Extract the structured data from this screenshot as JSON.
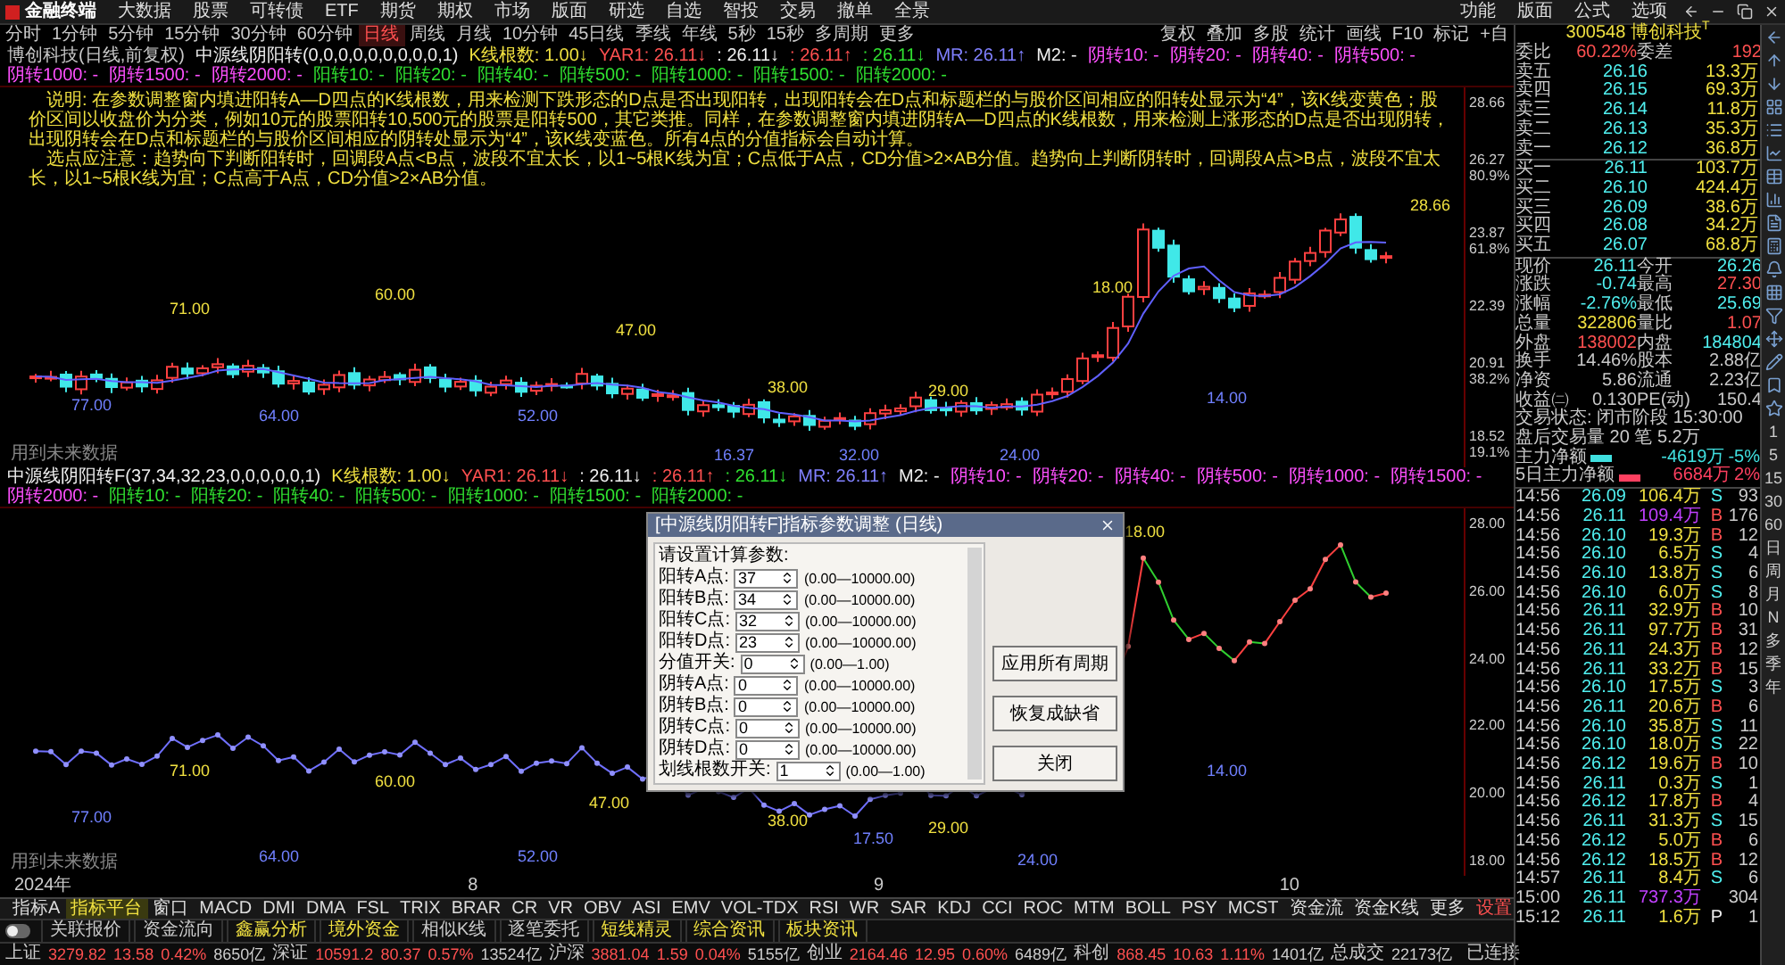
{
  "top_bar": {
    "logo": "金融终端",
    "menu": [
      "大数据",
      "股票",
      "可转债",
      "ETF",
      "期货",
      "期权",
      "市场",
      "版面",
      "研选",
      "自选",
      "智投",
      "交易",
      "撤单",
      "全景"
    ],
    "right_menu": [
      "功能",
      "版面",
      "公式",
      "选项"
    ]
  },
  "period_bar": {
    "periods": [
      {
        "label": "分时",
        "selected": false
      },
      {
        "label": "1分钟",
        "selected": false
      },
      {
        "label": "5分钟",
        "selected": false
      },
      {
        "label": "15分钟",
        "selected": false
      },
      {
        "label": "30分钟",
        "selected": false
      },
      {
        "label": "60分钟",
        "selected": false
      },
      {
        "label": "日线",
        "selected": true
      },
      {
        "label": "周线",
        "selected": false
      },
      {
        "label": "月线",
        "selected": false
      },
      {
        "label": "10分钟",
        "selected": false
      },
      {
        "label": "45日线",
        "selected": false
      },
      {
        "label": "季线",
        "selected": false
      },
      {
        "label": "年线",
        "selected": false
      },
      {
        "label": "5秒",
        "selected": false
      },
      {
        "label": "15秒",
        "selected": false
      },
      {
        "label": "多周期",
        "selected": false
      },
      {
        "label": "更多",
        "selected": false
      }
    ],
    "tools": [
      "复权",
      "叠加",
      "多股",
      "统计",
      "画线",
      "F10",
      "标记",
      "+自"
    ]
  },
  "main_header": [
    {
      "text": "博创科技(日线,前复权)",
      "color": "#c8c8c8"
    },
    {
      "text": "中源线阴阳转(0,0,0,0,0,0,0,0,0,1)",
      "color": "#f0f0f0"
    },
    {
      "text": "K线根数: 1.00↓",
      "color": "#f0e040"
    },
    {
      "text": "YAR1: 26.11↓",
      "color": "#ff5050"
    },
    {
      "text": ": 26.11↓",
      "color": "#f0f0f0"
    },
    {
      "text": ": 26.11↑",
      "color": "#ff5050"
    },
    {
      "text": ": 26.11↓",
      "color": "#30e030"
    },
    {
      "text": "MR: 26.11↑",
      "color": "#8080ff"
    },
    {
      "text": "M2: -",
      "color": "#f0f0f0"
    },
    {
      "text": "阴转10: -",
      "color": "#ff50ff"
    },
    {
      "text": "阴转20: -",
      "color": "#ff50ff"
    },
    {
      "text": "阴转40: -",
      "color": "#ff50ff"
    },
    {
      "text": "阴转500: -",
      "color": "#ff50ff"
    },
    {
      "text": "阴转1000: -",
      "color": "#ff50ff"
    },
    {
      "text": "阴转1500: -",
      "color": "#ff50ff"
    },
    {
      "text": "阴转2000: -",
      "color": "#ff50ff"
    },
    {
      "text": "阳转10: -",
      "color": "#30e030"
    },
    {
      "text": "阳转20: -",
      "color": "#30e030"
    },
    {
      "text": "阳转40: -",
      "color": "#30e030"
    },
    {
      "text": "阳转500: -",
      "color": "#30e030"
    },
    {
      "text": "阳转1000: -",
      "color": "#30e030"
    },
    {
      "text": "阳转1500: -",
      "color": "#30e030"
    },
    {
      "text": "阳转2000: -",
      "color": "#30e030"
    }
  ],
  "explanation": [
    "说明: 在参数调整窗内填进阳转A—D四点的K线根数，用来检测下跌形态的D点是否出现阳转，出现阳转会在D点和标题栏的与股价区间相应的阳转处显示为“4”，该K线变黄色；股价区间以收盘价为分类，例如10元的股票阳转10,500元的股票是阳转500，其它类推。同样，在参数调整窗内填进阴转A—D四点的K线根数，用来检测上涨形态的D点是否出现阴转，出现阴转会在D点和标题栏的与股价区间相应的阴转处显示为“4”，该K线变蓝色。所有4点的分值指标会自动计算。",
    "选点应注意：趋势向下判断阳转时，回调段A点<B点，波段不宜太长，以1~5根K线为宜；C点低于A点，CD分值>2×AB分值。趋势向上判断阴转时，回调段A点>B点，波段不宜太长，以1~5根K线为宜；C点高于A点，CD分值>2×AB分值。"
  ],
  "main_chart": {
    "labels": [
      "71.00",
      "60.00",
      "47.00",
      "38.00",
      "29.00",
      "18.00",
      "28.66",
      "77.00",
      "64.00",
      "52.00",
      "16.37",
      "32.00",
      "24.00",
      "14.00"
    ],
    "note": "用到未来数据",
    "axis": [
      {
        "value": "28.66"
      },
      {
        "value": "26.27",
        "pct": "80.9%"
      },
      {
        "value": "23.87",
        "pct": "61.8%"
      },
      {
        "value": "22.39"
      },
      {
        "value": "20.91",
        "pct": "38.2%"
      },
      {
        "value": "18.52",
        "pct": "19.1%"
      }
    ]
  },
  "lower_header": [
    {
      "text": "中源线阴阳转F(37,34,32,23,0,0,0,0,0,1)",
      "color": "#f0f0f0"
    },
    {
      "text": "K线根数: 1.00↓",
      "color": "#f0e040"
    },
    {
      "text": "YAR1: 26.11↓",
      "color": "#ff5050"
    },
    {
      "text": ": 26.11↓",
      "color": "#f0f0f0"
    },
    {
      "text": ": 26.11↑",
      "color": "#ff5050"
    },
    {
      "text": ": 26.11↓",
      "color": "#30e030"
    },
    {
      "text": "MR: 26.11↑",
      "color": "#8080ff"
    },
    {
      "text": "M2: -",
      "color": "#f0f0f0"
    },
    {
      "text": "阴转10: -",
      "color": "#ff50ff"
    },
    {
      "text": "阴转20: -",
      "color": "#ff50ff"
    },
    {
      "text": "阴转40: -",
      "color": "#ff50ff"
    },
    {
      "text": "阴转500: -",
      "color": "#ff50ff"
    },
    {
      "text": "阴转1000: -",
      "color": "#ff50ff"
    },
    {
      "text": "阴转1500: -",
      "color": "#ff50ff"
    },
    {
      "text": "阴转2000: -",
      "color": "#ff50ff"
    },
    {
      "text": "阳转10: -",
      "color": "#30e030"
    },
    {
      "text": "阳转20: -",
      "color": "#30e030"
    },
    {
      "text": "阳转40: -",
      "color": "#30e030"
    },
    {
      "text": "阳转500: -",
      "color": "#30e030"
    },
    {
      "text": "阳转1000: -",
      "color": "#30e030"
    },
    {
      "text": "阳转1500: -",
      "color": "#30e030"
    },
    {
      "text": "阳转2000: -",
      "color": "#30e030"
    }
  ],
  "lower_chart": {
    "labels": [
      "71.00",
      "60.00",
      "47.00",
      "38.00",
      "29.00",
      "18.00",
      "77.00",
      "64.00",
      "52.00",
      "14.00",
      "24.00",
      "17.50"
    ],
    "note": "用到未来数据",
    "axis": [
      "28.00",
      "26.00",
      "24.00",
      "22.00",
      "20.00",
      "18.00"
    ]
  },
  "date_axis": [
    "2024年",
    "8",
    "9",
    "10"
  ],
  "dialog": {
    "title": "[中源线阴阳转F]指标参数调整 (日线)",
    "prompt": "请设置计算参数:",
    "params": [
      {
        "label": "阳转A点:",
        "value": "37",
        "range": "(0.00—10000.00)"
      },
      {
        "label": "阳转B点:",
        "value": "34",
        "range": "(0.00—10000.00)"
      },
      {
        "label": "阳转C点:",
        "value": "32",
        "range": "(0.00—10000.00)"
      },
      {
        "label": "阳转D点:",
        "value": "23",
        "range": "(0.00—10000.00)"
      },
      {
        "label": "分值开关:",
        "value": "0",
        "range": "(0.00—1.00)"
      },
      {
        "label": "阴转A点:",
        "value": "0",
        "range": "(0.00—10000.00)"
      },
      {
        "label": "阴转B点:",
        "value": "0",
        "range": "(0.00—10000.00)"
      },
      {
        "label": "阴转C点:",
        "value": "0",
        "range": "(0.00—10000.00)"
      },
      {
        "label": "阴转D点:",
        "value": "0",
        "range": "(0.00—10000.00)"
      },
      {
        "label": "划线根数开关:",
        "value": "1",
        "range": "(0.00—1.00)"
      }
    ],
    "buttons": [
      "应用所有周期",
      "恢复成缺省",
      "关闭"
    ]
  },
  "indicator_tabs": [
    {
      "label": "指标A",
      "selected": false,
      "kind": "tab"
    },
    {
      "label": "指标平台",
      "selected": true,
      "kind": "tab"
    },
    {
      "label": "窗口",
      "selected": false,
      "kind": "tab"
    },
    {
      "label": "MACD",
      "selected": false,
      "kind": "tab"
    },
    {
      "label": "DMI",
      "selected": false,
      "kind": "tab"
    },
    {
      "label": "DMA",
      "selected": false,
      "kind": "tab"
    },
    {
      "label": "FSL",
      "selected": false,
      "kind": "tab"
    },
    {
      "label": "TRIX",
      "selected": false,
      "kind": "tab"
    },
    {
      "label": "BRAR",
      "selected": false,
      "kind": "tab"
    },
    {
      "label": "CR",
      "selected": false,
      "kind": "tab"
    },
    {
      "label": "VR",
      "selected": false,
      "kind": "tab"
    },
    {
      "label": "OBV",
      "selected": false,
      "kind": "tab"
    },
    {
      "label": "ASI",
      "selected": false,
      "kind": "tab"
    },
    {
      "label": "EMV",
      "selected": false,
      "kind": "tab"
    },
    {
      "label": "VOL-TDX",
      "selected": false,
      "kind": "tab"
    },
    {
      "label": "RSI",
      "selected": false,
      "kind": "tab"
    },
    {
      "label": "WR",
      "selected": false,
      "kind": "tab"
    },
    {
      "label": "SAR",
      "selected": false,
      "kind": "tab"
    },
    {
      "label": "KDJ",
      "selected": false,
      "kind": "tab"
    },
    {
      "label": "CCI",
      "selected": false,
      "kind": "tab"
    },
    {
      "label": "ROC",
      "selected": false,
      "kind": "tab"
    },
    {
      "label": "MTM",
      "selected": false,
      "kind": "tab"
    },
    {
      "label": "BOLL",
      "selected": false,
      "kind": "tab"
    },
    {
      "label": "PSY",
      "selected": false,
      "kind": "tab"
    },
    {
      "label": "MCST",
      "selected": false,
      "kind": "tab"
    },
    {
      "label": "资金流",
      "selected": false,
      "kind": "tab"
    },
    {
      "label": "资金K线",
      "selected": false,
      "kind": "tab"
    },
    {
      "label": "更多",
      "selected": false,
      "kind": "tab"
    },
    {
      "label": "设置",
      "selected": false,
      "kind": "settings"
    }
  ],
  "info_bar": {
    "toggle_on": false,
    "tabs": [
      {
        "label": "关联报价",
        "highlight": false
      },
      {
        "label": "资金流向",
        "highlight": false
      },
      {
        "label": "鑫赢分析",
        "highlight": true
      },
      {
        "label": "境外资金",
        "highlight": true
      },
      {
        "label": "相似K线",
        "highlight": false
      },
      {
        "label": "逐笔委托",
        "highlight": false
      },
      {
        "label": "短线精灵",
        "highlight": true
      },
      {
        "label": "综合资讯",
        "highlight": true
      },
      {
        "label": "板块资讯",
        "highlight": true
      }
    ]
  },
  "status_bar": {
    "indices": [
      {
        "name": "上证",
        "value": "3279.82",
        "change": "13.58",
        "pct": "0.42%",
        "amount": "8650亿"
      },
      {
        "name": "深证",
        "value": "10591.2",
        "change": "80.37",
        "pct": "0.57%",
        "amount": "13524亿"
      },
      {
        "name": "沪深",
        "value": "3881.04",
        "change": "1.59",
        "pct": "0.04%",
        "amount": "5155亿"
      },
      {
        "name": "创业",
        "value": "2164.46",
        "change": "12.95",
        "pct": "0.60%",
        "amount": "6489亿"
      },
      {
        "name": "科创",
        "value": "868.45",
        "change": "10.63",
        "pct": "1.11%",
        "amount": "1401亿"
      }
    ],
    "total_label": "总成交",
    "total": "22173亿",
    "connection": "已连接"
  },
  "quote": {
    "code": "300548",
    "name": "博创科技$^{T}$",
    "ratio": [
      {
        "text": "委比",
        "color": "#c8c8c8"
      },
      {
        "text": "60.22%",
        "color": "#ff5050"
      },
      {
        "text": "委差",
        "color": "#c8c8c8"
      },
      {
        "text": "192",
        "color": "#ff5050"
      }
    ],
    "book": [
      {
        "label": "卖五",
        "price": "26.16",
        "volume": "13.3万"
      },
      {
        "label": "卖四",
        "price": "26.15",
        "volume": "69.3万"
      },
      {
        "label": "卖三",
        "price": "26.14",
        "volume": "11.8万"
      },
      {
        "label": "卖二",
        "price": "26.13",
        "volume": "35.3万"
      },
      {
        "label": "卖一",
        "price": "26.12",
        "volume": "36.8万"
      },
      {
        "label": "买一",
        "price": "26.11",
        "volume": "103.7万"
      },
      {
        "label": "买二",
        "price": "26.10",
        "volume": "424.4万"
      },
      {
        "label": "买三",
        "price": "26.09",
        "volume": "38.6万"
      },
      {
        "label": "买四",
        "price": "26.08",
        "volume": "34.2万"
      },
      {
        "label": "买五",
        "price": "26.07",
        "volume": "68.8万"
      }
    ],
    "stats": [
      [
        {
          "text": "现价",
          "color": "#c8c8c8"
        },
        {
          "text": "26.11",
          "color": "#50f0f0"
        },
        {
          "text": "今开",
          "color": "#c8c8c8"
        },
        {
          "text": "26.26",
          "color": "#50f0f0"
        }
      ],
      [
        {
          "text": "涨跌",
          "color": "#c8c8c8"
        },
        {
          "text": "-0.74",
          "color": "#50f0f0"
        },
        {
          "text": "最高",
          "color": "#c8c8c8"
        },
        {
          "text": "27.30",
          "color": "#ff5050"
        }
      ],
      [
        {
          "text": "涨幅",
          "color": "#c8c8c8"
        },
        {
          "text": "-2.76%",
          "color": "#50f0f0"
        },
        {
          "text": "最低",
          "color": "#c8c8c8"
        },
        {
          "text": "25.69",
          "color": "#50f0f0"
        }
      ],
      [
        {
          "text": "总量",
          "color": "#c8c8c8"
        },
        {
          "text": "322806",
          "color": "#f0e040"
        },
        {
          "text": "量比",
          "color": "#c8c8c8"
        },
        {
          "text": "1.07",
          "color": "#ff5050"
        }
      ],
      [
        {
          "text": "外盘",
          "color": "#c8c8c8"
        },
        {
          "text": "138002",
          "color": "#ff5050"
        },
        {
          "text": "内盘",
          "color": "#c8c8c8"
        },
        {
          "text": "184804",
          "color": "#50f0f0"
        }
      ],
      [
        {
          "text": "换手",
          "color": "#c8c8c8"
        },
        {
          "text": "14.46%",
          "color": "#c8c8c8"
        },
        {
          "text": "股本",
          "color": "#c8c8c8"
        },
        {
          "text": "2.88亿",
          "color": "#c8c8c8"
        }
      ],
      [
        {
          "text": "净资",
          "color": "#c8c8c8"
        },
        {
          "text": "5.86",
          "color": "#c8c8c8"
        },
        {
          "text": "流通",
          "color": "#c8c8c8"
        },
        {
          "text": "2.23亿",
          "color": "#c8c8c8"
        }
      ],
      [
        {
          "text": "收益㈡",
          "color": "#c8c8c8"
        },
        {
          "text": "0.130",
          "color": "#c8c8c8"
        },
        {
          "text": "PE(动)",
          "color": "#c8c8c8"
        },
        {
          "text": "150.4",
          "color": "#c8c8c8"
        }
      ]
    ],
    "trade_status": "交易状态: 闭市阶段 15:30:00",
    "after_hours": "盘后交易量 20 笔 5.2万",
    "flows": [
      {
        "label": "主力净额",
        "value": "-4619万",
        "pct": "-5%",
        "color": "#40e0e0"
      },
      {
        "label": "5日主力净额",
        "value": "6684万",
        "pct": "2%",
        "color": "#ff4060"
      }
    ],
    "ticks": [
      {
        "time": "14:56",
        "price": "26.09",
        "volume": "106.4万",
        "side": "S",
        "count": "93",
        "big": false
      },
      {
        "time": "14:56",
        "price": "26.11",
        "volume": "109.4万",
        "side": "B",
        "count": "176",
        "big": true
      },
      {
        "time": "14:56",
        "price": "26.10",
        "volume": "19.3万",
        "side": "B",
        "count": "12",
        "big": false
      },
      {
        "time": "14:56",
        "price": "26.10",
        "volume": "6.5万",
        "side": "S",
        "count": "4",
        "big": false
      },
      {
        "time": "14:56",
        "price": "26.10",
        "volume": "13.8万",
        "side": "S",
        "count": "6",
        "big": false
      },
      {
        "time": "14:56",
        "price": "26.10",
        "volume": "6.0万",
        "side": "S",
        "count": "8",
        "big": false
      },
      {
        "time": "14:56",
        "price": "26.11",
        "volume": "32.9万",
        "side": "B",
        "count": "10",
        "big": false
      },
      {
        "time": "14:56",
        "price": "26.11",
        "volume": "97.7万",
        "side": "B",
        "count": "31",
        "big": false
      },
      {
        "time": "14:56",
        "price": "26.11",
        "volume": "24.3万",
        "side": "B",
        "count": "12",
        "big": false
      },
      {
        "time": "14:56",
        "price": "26.11",
        "volume": "33.2万",
        "side": "B",
        "count": "15",
        "big": false
      },
      {
        "time": "14:56",
        "price": "26.10",
        "volume": "17.5万",
        "side": "S",
        "count": "3",
        "big": false
      },
      {
        "time": "14:56",
        "price": "26.11",
        "volume": "20.6万",
        "side": "B",
        "count": "6",
        "big": false
      },
      {
        "time": "14:56",
        "price": "26.10",
        "volume": "35.8万",
        "side": "S",
        "count": "11",
        "big": false
      },
      {
        "time": "14:56",
        "price": "26.10",
        "volume": "18.0万",
        "side": "S",
        "count": "22",
        "big": false
      },
      {
        "time": "14:56",
        "price": "26.12",
        "volume": "19.6万",
        "side": "B",
        "count": "10",
        "big": false
      },
      {
        "time": "14:56",
        "price": "26.11",
        "volume": "0.3万",
        "side": "S",
        "count": "1",
        "big": false
      },
      {
        "time": "14:56",
        "price": "26.12",
        "volume": "17.8万",
        "side": "B",
        "count": "4",
        "big": false
      },
      {
        "time": "14:56",
        "price": "26.11",
        "volume": "31.3万",
        "side": "S",
        "count": "15",
        "big": false
      },
      {
        "time": "14:56",
        "price": "26.12",
        "volume": "5.0万",
        "side": "B",
        "count": "6",
        "big": false
      },
      {
        "time": "14:56",
        "price": "26.12",
        "volume": "18.5万",
        "side": "B",
        "count": "12",
        "big": false
      },
      {
        "time": "14:57",
        "price": "26.11",
        "volume": "8.4万",
        "side": "S",
        "count": "6",
        "big": false
      },
      {
        "time": "15:00",
        "price": "26.11",
        "volume": "737.3万",
        "count": "304",
        "big": true
      },
      {
        "time": "15:12",
        "price": "26.11",
        "volume": "1.6万",
        "side": "P",
        "count": "1",
        "big": false
      }
    ]
  },
  "side_periods": [
    "1",
    "5",
    "15",
    "30",
    "60",
    "日",
    "周",
    "月",
    "N",
    "多",
    "季",
    "年"
  ]
}
